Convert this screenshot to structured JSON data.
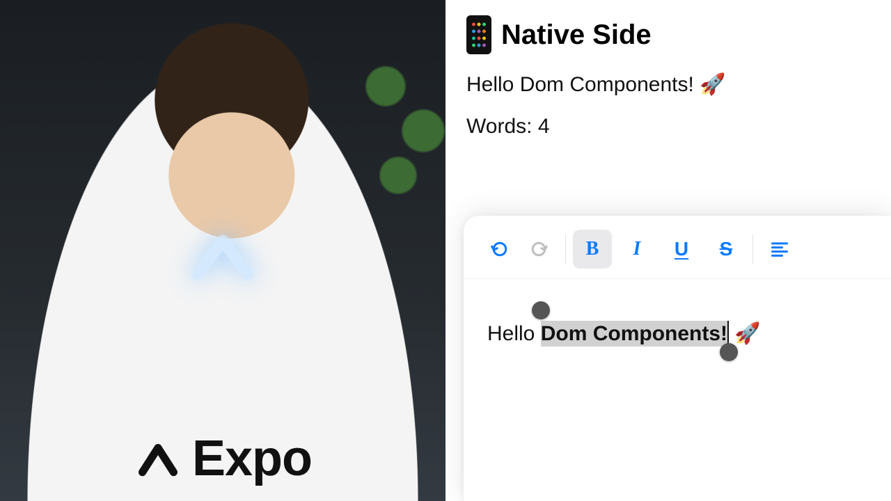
{
  "presenter": {
    "shirt_brand": "Expo",
    "background_logo": "chevron"
  },
  "native": {
    "title": "Native Side",
    "greeting": "Hello Dom Components! 🚀",
    "word_label": "Words:",
    "word_count": "4"
  },
  "editor": {
    "toolbar": {
      "undo": "undo",
      "redo": "redo",
      "bold": "B",
      "italic": "I",
      "underline": "U",
      "strike": "S",
      "align": "align-left",
      "active": "bold",
      "redo_disabled": true
    },
    "content": {
      "prefix": "Hello ",
      "selected": "Dom Components!",
      "suffix_emoji": "🚀"
    }
  },
  "colors": {
    "accent": "#0a7aff"
  }
}
